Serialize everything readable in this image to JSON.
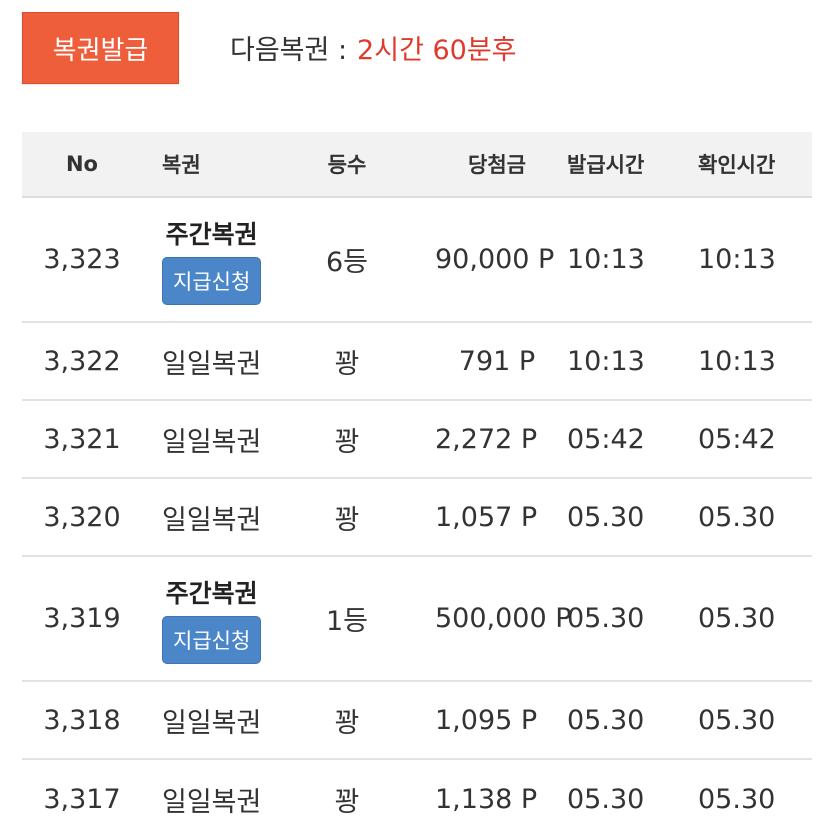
{
  "top": {
    "issue_button": "복권발급",
    "next_label": "다음복권 :",
    "next_value": "2시간 60분후"
  },
  "table": {
    "headers": {
      "no": "No",
      "type": "복권",
      "rank": "등수",
      "prize": "당첨금",
      "issue_time": "발급시간",
      "confirm_time": "확인시간"
    },
    "pay_label": "지급신청",
    "rows": [
      {
        "no": "3,323",
        "type": "주간복권",
        "rank": "6등",
        "prize": "90,000 P",
        "issue_time": "10:13",
        "confirm_time": "10:13",
        "has_pay": true
      },
      {
        "no": "3,322",
        "type": "일일복권",
        "rank": "꽝",
        "prize": "791 P",
        "issue_time": "10:13",
        "confirm_time": "10:13",
        "has_pay": false
      },
      {
        "no": "3,321",
        "type": "일일복권",
        "rank": "꽝",
        "prize": "2,272 P",
        "issue_time": "05:42",
        "confirm_time": "05:42",
        "has_pay": false
      },
      {
        "no": "3,320",
        "type": "일일복권",
        "rank": "꽝",
        "prize": "1,057 P",
        "issue_time": "05.30",
        "confirm_time": "05.30",
        "has_pay": false
      },
      {
        "no": "3,319",
        "type": "주간복권",
        "rank": "1등",
        "prize": "500,000 P",
        "issue_time": "05.30",
        "confirm_time": "05.30",
        "has_pay": true
      },
      {
        "no": "3,318",
        "type": "일일복권",
        "rank": "꽝",
        "prize": "1,095 P",
        "issue_time": "05.30",
        "confirm_time": "05.30",
        "has_pay": false
      },
      {
        "no": "3,317",
        "type": "일일복권",
        "rank": "꽝",
        "prize": "1,138 P",
        "issue_time": "05.30",
        "confirm_time": "05.30",
        "has_pay": false
      }
    ]
  }
}
